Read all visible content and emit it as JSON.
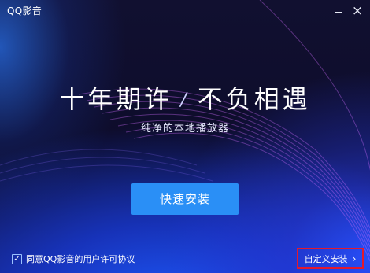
{
  "window": {
    "title": "QQ影音",
    "minimize_icon": "minimize-icon",
    "close_icon": "close-icon",
    "close_glyph": "×"
  },
  "hero": {
    "headline_left": "十年期许",
    "headline_separator": "/",
    "headline_right": "不负相遇",
    "tagline": "纯净的本地播放器"
  },
  "actions": {
    "install_label": "快速安装",
    "agreement_checked": true,
    "agreement_check_glyph": "✓",
    "agreement_text": "同意QQ影音的用户许可协议",
    "custom_install_label": "自定义安装",
    "custom_install_chevron": "›"
  },
  "colors": {
    "install_button": "#2a8ff6",
    "highlight_border": "#e3192e",
    "background_dark": "#0d0c2b",
    "background_blue": "#2050ff"
  }
}
